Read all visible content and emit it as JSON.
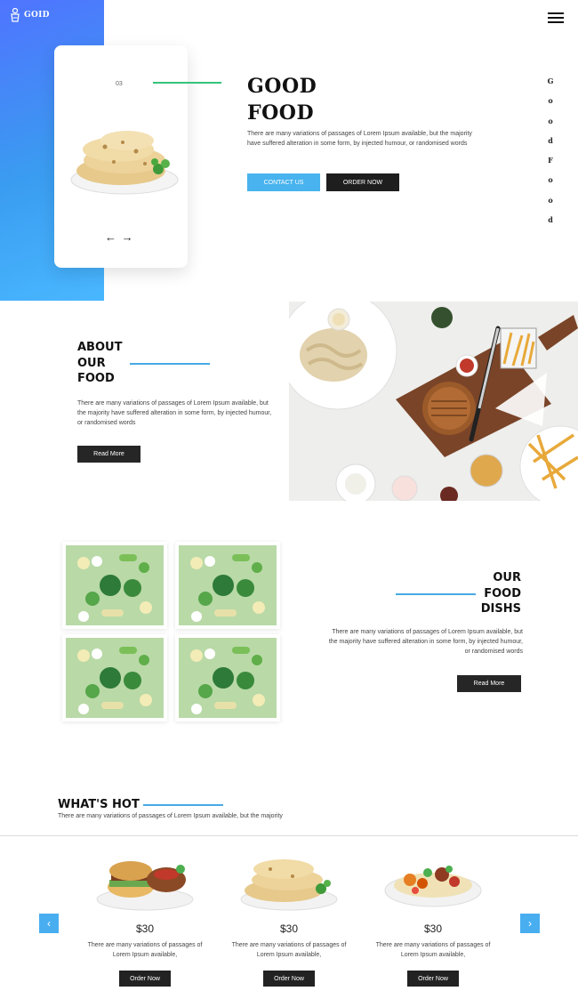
{
  "brand": {
    "logo_text": "GOID",
    "accent": "#48a9e6",
    "hero_line_color": "#34c37a"
  },
  "nav": {
    "menu_icon": "hamburger-icon"
  },
  "hero": {
    "slide_number": "03",
    "title_line1": "GOOD",
    "title_line2": "FOOD",
    "text": "There are many variations of passages of Lorem Ipsum available, but the majority have suffered alteration in some form, by injected humour, or randomised words",
    "contact_label": "CONTACT US",
    "order_label": "ORDER NOW",
    "prev_arrow": "←",
    "next_arrow": "→",
    "vertical_letters": [
      "G",
      "o",
      "o",
      "d",
      "F",
      "o",
      "o",
      "d"
    ]
  },
  "about": {
    "title": "ABOUT\nOUR\nFOOD",
    "text": "There are many variations of passages of Lorem Ipsum available, but the majority have suffered alteration in some form, by injected humour, or randomised words",
    "button_label": "Read More"
  },
  "dishes": {
    "title": "OUR\nFOOD\nDISHS",
    "text": "There are many variations of passages of Lorem Ipsum available, but the majority have suffered alteration in some form, by injected humour, or randomised words",
    "button_label": "Read More"
  },
  "whats_hot": {
    "title": "WHAT'S HOT",
    "subtitle": "There are many variations of passages of Lorem Ipsum available, but the majority",
    "prev_icon": "‹",
    "next_icon": "›",
    "items": [
      {
        "price": "$30",
        "text": "There are many variations of passages of Lorem Ipsum available,",
        "button": "Order Now"
      },
      {
        "price": "$30",
        "text": "There are many variations of passages of Lorem Ipsum available,",
        "button": "Order Now"
      },
      {
        "price": "$30",
        "text": "There are many variations of passages of Lorem Ipsum available,",
        "button": "Order Now"
      }
    ]
  }
}
